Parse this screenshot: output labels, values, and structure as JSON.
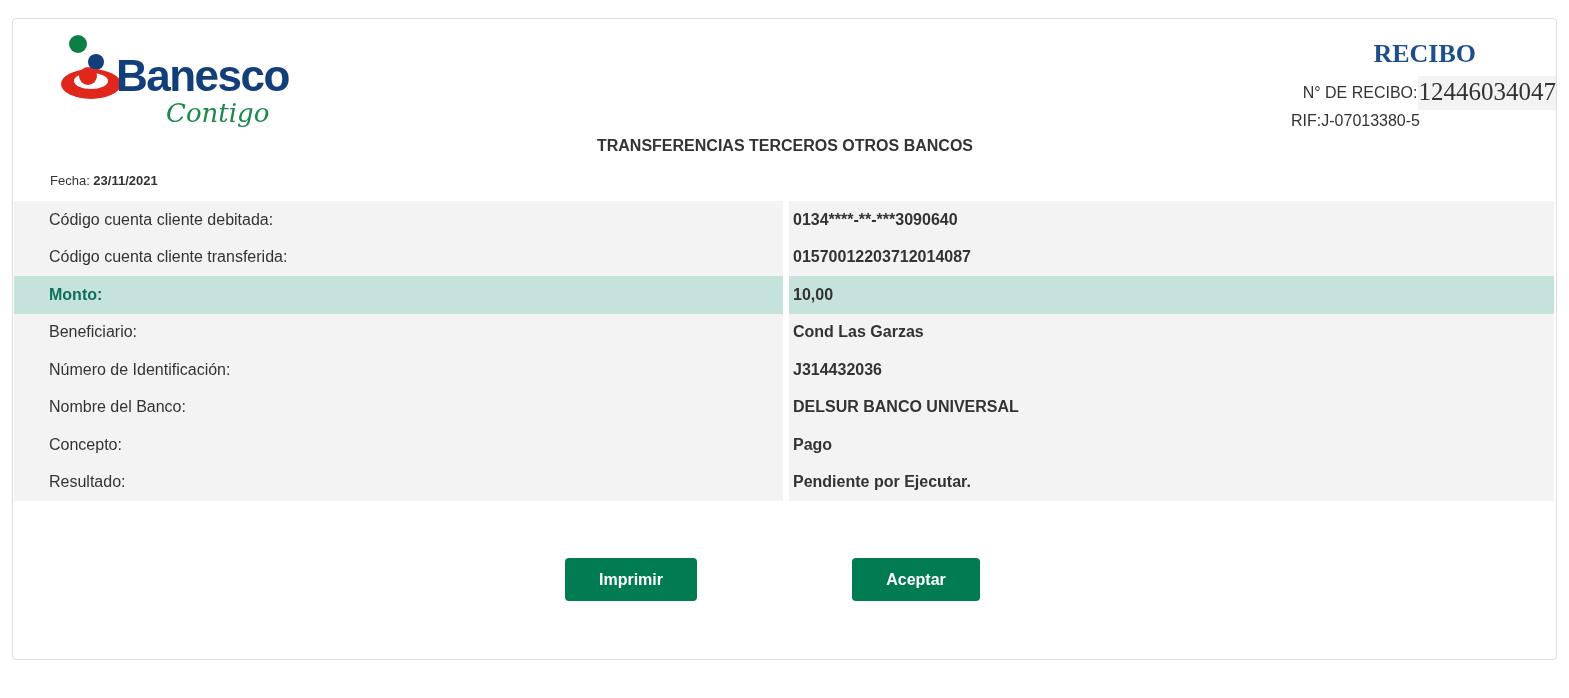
{
  "logo": {
    "name": "Banesco",
    "tagline": "Contigo"
  },
  "receipt": {
    "title": "RECIBO",
    "number_label": "N° DE RECIBO:",
    "number": "12446034047",
    "rif": "RIF:J-07013380-5"
  },
  "heading": "TRANSFERENCIAS TERCEROS OTROS BANCOS",
  "date": "Fecha: **23/11/2021**",
  "rows": [
    {
      "label": "Código cuenta cliente debitada:",
      "value": "0134****-**-***3090640",
      "highlight": false
    },
    {
      "label": "Código cuenta cliente transferida:",
      "value": "01570012203712014087",
      "highlight": false
    },
    {
      "label": "Monto:",
      "value": "10,00",
      "highlight": true
    },
    {
      "label": "Beneficiario:",
      "value": "Cond Las Garzas",
      "highlight": false
    },
    {
      "label": "Número de Identificación:",
      "value": "J314432036",
      "highlight": false
    },
    {
      "label": "Nombre del Banco:",
      "value": "DELSUR BANCO UNIVERSAL",
      "highlight": false
    },
    {
      "label": "Concepto:",
      "value": "Pago",
      "highlight": false
    },
    {
      "label": "Resultado:",
      "value": "Pendiente por Ejecutar.",
      "highlight": false
    }
  ],
  "buttons": [
    "Imprimir",
    "Aceptar"
  ]
}
